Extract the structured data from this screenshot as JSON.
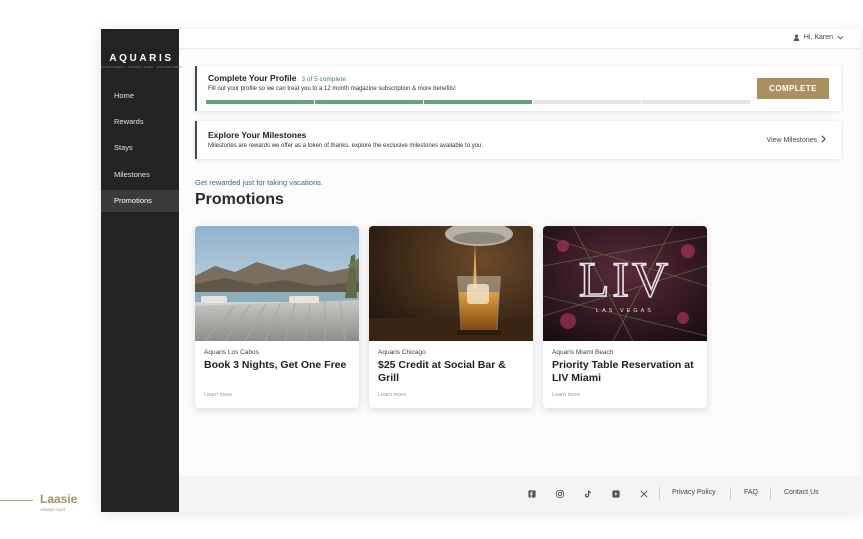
{
  "brand": {
    "name": "AQUARIS",
    "subtitle": "ACCESS EVERY · CONNECT EVERY · EXPLORE EVERY"
  },
  "sidebar": {
    "items": [
      {
        "label": "Home",
        "active": false
      },
      {
        "label": "Rewards",
        "active": false
      },
      {
        "label": "Stays",
        "active": false
      },
      {
        "label": "Milestones",
        "active": false
      },
      {
        "label": "Promotions",
        "active": true
      }
    ]
  },
  "topbar": {
    "greeting": "Hi, Karen",
    "user_icon": "user-icon",
    "chevron_icon": "chevron-down-icon"
  },
  "profile": {
    "title": "Complete Your Profile",
    "progress_text": "3 of 5 complete",
    "progress_completed": 3,
    "progress_total": 5,
    "description": "Fill out your profile so we can treat you to a 12 month magazine subscription & more benefits!",
    "button_label": "COMPLETE"
  },
  "milestones": {
    "title": "Explore Your Milestones",
    "description": "Milestones are rewards we offer as a token of thanks, explore the exclusive milestones available to you.",
    "link_label": "View Milestones"
  },
  "main": {
    "tagline": "Get rewarded just for taking vacations.",
    "heading": "Promotions"
  },
  "promotions": [
    {
      "location": "Aquaris Los Cabos",
      "title": "Book 3 Nights, Get One Free",
      "link": "Learn more"
    },
    {
      "location": "Aquaris Chicago",
      "title": "$25 Credit at Social Bar & Grill",
      "link": "Learn more"
    },
    {
      "location": "Aquaris Miami Beach",
      "title": "Priority Table Reservation at LIV Miami",
      "link": "Learn more",
      "image_text": {
        "logo": "LIV",
        "sub": "LAS VEGAS"
      }
    }
  ],
  "footer": {
    "social": [
      "facebook-icon",
      "instagram-icon",
      "tiktok-icon",
      "youtube-icon",
      "x-icon"
    ],
    "links": [
      "Privacy Policy",
      "FAQ",
      "Contact Us"
    ]
  },
  "watermark": {
    "name": "Laasie",
    "tagline": "Always loyal."
  },
  "colors": {
    "accent": "#a89060",
    "sidebar": "#232323",
    "progress": "#6aa277",
    "link": "#3b6f86"
  }
}
